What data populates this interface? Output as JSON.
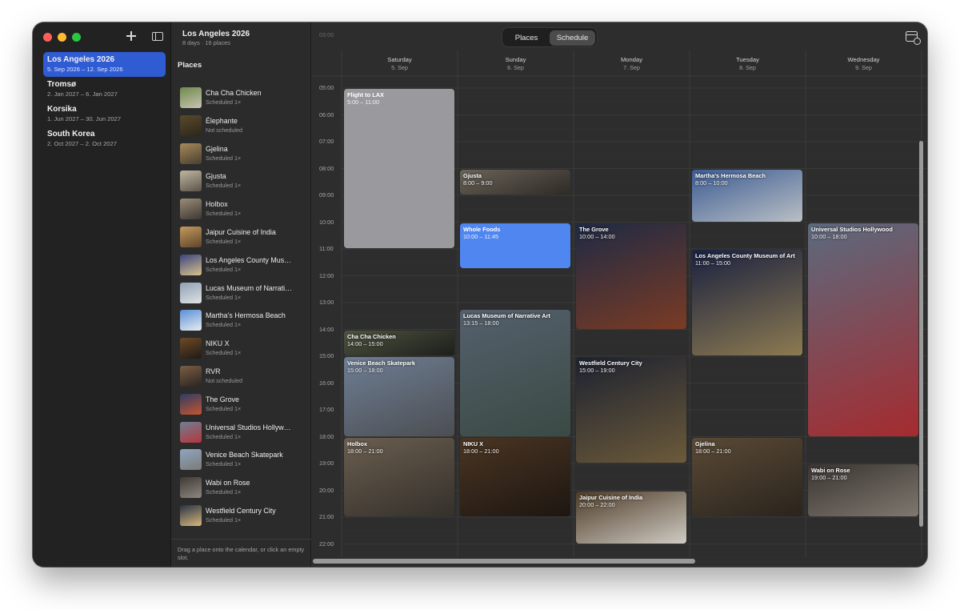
{
  "trip_header": {
    "title": "Los Angeles 2026",
    "subtitle": "8 days · 16 places"
  },
  "trips": [
    {
      "name": "Los Angeles 2026",
      "dates": "5. Sep 2026 – 12. Sep 2026",
      "selected": true
    },
    {
      "name": "Tromsø",
      "dates": "2. Jan 2027 – 6. Jan 2027",
      "selected": false
    },
    {
      "name": "Korsika",
      "dates": "1. Jun 2027 – 30. Jun 2027",
      "selected": false
    },
    {
      "name": "South Korea",
      "dates": "2. Oct 2027 – 2. Oct 2027",
      "selected": false
    }
  ],
  "places": {
    "title": "Places",
    "items": [
      {
        "name": "Cha Cha Chicken",
        "status": "Scheduled 1×",
        "thumb": [
          "#6d8a4a",
          "#c9c3b3"
        ]
      },
      {
        "name": "Élephante",
        "status": "Not scheduled",
        "thumb": [
          "#5a4a2d",
          "#2c2619"
        ]
      },
      {
        "name": "Gjelina",
        "status": "Scheduled 1×",
        "thumb": [
          "#a68a5c",
          "#4a3f2e"
        ]
      },
      {
        "name": "Gjusta",
        "status": "Scheduled 1×",
        "thumb": [
          "#c0b6a3",
          "#5c5548"
        ]
      },
      {
        "name": "Holbox",
        "status": "Scheduled 1×",
        "thumb": [
          "#9b8d78",
          "#3d3832"
        ]
      },
      {
        "name": "Jaipur Cuisine of India",
        "status": "Scheduled 1×",
        "thumb": [
          "#c49a5d",
          "#5e452b"
        ]
      },
      {
        "name": "Los Angeles County Mus…",
        "status": "Scheduled 1×",
        "thumb": [
          "#3b4480",
          "#d9c28a"
        ]
      },
      {
        "name": "Lucas Museum of Narrati…",
        "status": "Scheduled 1×",
        "thumb": [
          "#8ea0b4",
          "#dfe2e3"
        ]
      },
      {
        "name": "Martha's Hermosa Beach",
        "status": "Scheduled 1×",
        "thumb": [
          "#5b8fd6",
          "#e7ecef"
        ]
      },
      {
        "name": "NIKU X",
        "status": "Scheduled 1×",
        "thumb": [
          "#6f4a27",
          "#1f1a15"
        ]
      },
      {
        "name": "RVR",
        "status": "Not scheduled",
        "thumb": [
          "#7a5e44",
          "#2b2520"
        ]
      },
      {
        "name": "The Grove",
        "status": "Scheduled 1×",
        "thumb": [
          "#2d3c63",
          "#c6552f"
        ]
      },
      {
        "name": "Universal Studios Hollyw…",
        "status": "Scheduled 1×",
        "thumb": [
          "#6e7f94",
          "#b6363a"
        ]
      },
      {
        "name": "Venice Beach Skatepark",
        "status": "Scheduled 1×",
        "thumb": [
          "#8ea6c2",
          "#7d7a76"
        ]
      },
      {
        "name": "Wabi on Rose",
        "status": "Scheduled 1×",
        "thumb": [
          "#3f3935",
          "#8e8780"
        ]
      },
      {
        "name": "Westfield Century City",
        "status": "Scheduled 1×",
        "thumb": [
          "#2a3243",
          "#d7b77c"
        ]
      }
    ],
    "footer": "Drag a place onto the calendar, or click an empty slot."
  },
  "view_toggle": {
    "places": "Places",
    "schedule": "Schedule"
  },
  "days": [
    {
      "name": "Saturday",
      "date": "5. Sep"
    },
    {
      "name": "Sunday",
      "date": "6. Sep"
    },
    {
      "name": "Monday",
      "date": "7. Sep"
    },
    {
      "name": "Tuesday",
      "date": "8. Sep"
    },
    {
      "name": "Wednesday",
      "date": "9. Sep"
    }
  ],
  "hours": [
    "03:00",
    "05:00",
    "06:00",
    "07:00",
    "08:00",
    "09:00",
    "10:00",
    "11:00",
    "12:00",
    "13:00",
    "14:00",
    "15:00",
    "16:00",
    "17:00",
    "18:00",
    "19:00",
    "20:00",
    "21:00",
    "22:00"
  ],
  "events": [
    {
      "day": 0,
      "start": 5,
      "end": 11,
      "title": "Flight to LAX",
      "time": "5:00 – 11:00",
      "style": "plain"
    },
    {
      "day": 0,
      "start": 14,
      "end": 15,
      "title": "Cha Cha Chicken",
      "time": "14:00 – 15:00",
      "style": "photo",
      "colors": [
        "#4e5440",
        "#1d1e1b"
      ]
    },
    {
      "day": 0,
      "start": 15,
      "end": 18,
      "title": "Venice Beach Skatepark",
      "time": "15:00 – 18:00",
      "style": "photo",
      "colors": [
        "#6e7e94",
        "#4c4e52"
      ]
    },
    {
      "day": 0,
      "start": 18,
      "end": 21,
      "title": "Holbox",
      "time": "18:00 – 21:00",
      "style": "photo",
      "colors": [
        "#6a5e4f",
        "#34302b"
      ]
    },
    {
      "day": 1,
      "start": 8,
      "end": 9,
      "title": "Gjusta",
      "time": "8:00 – 9:00",
      "style": "photo",
      "colors": [
        "#6a6359",
        "#2e2a25"
      ]
    },
    {
      "day": 1,
      "start": 10,
      "end": 11.75,
      "title": "Whole Foods",
      "time": "10:00 – 11:45",
      "style": "blue"
    },
    {
      "day": 1,
      "start": 13.25,
      "end": 18,
      "title": "Lucas Museum of Narrative Art",
      "time": "13:15 – 18:00",
      "style": "photo",
      "colors": [
        "#55606d",
        "#3a4a43"
      ]
    },
    {
      "day": 1,
      "start": 18,
      "end": 21,
      "title": "NIKU X",
      "time": "18:00 – 21:00",
      "style": "photo",
      "colors": [
        "#4a3523",
        "#1d1611"
      ]
    },
    {
      "day": 2,
      "start": 10,
      "end": 14,
      "title": "The Grove",
      "time": "10:00 – 14:00",
      "style": "photo",
      "colors": [
        "#1f2a44",
        "#7a3b24"
      ]
    },
    {
      "day": 2,
      "start": 15,
      "end": 19,
      "title": "Westfield Century City",
      "time": "15:00 – 19:00",
      "style": "photo",
      "colors": [
        "#1d2230",
        "#6c5a3a"
      ]
    },
    {
      "day": 2,
      "start": 20,
      "end": 22,
      "title": "Jaipur Cuisine of India",
      "time": "20:00 – 22:00",
      "style": "photo",
      "colors": [
        "#4d3b27",
        "#cfcbc3"
      ]
    },
    {
      "day": 3,
      "start": 8,
      "end": 10,
      "title": "Martha's Hermosa Beach",
      "time": "8:00 – 10:00",
      "style": "photo",
      "colors": [
        "#3c5c93",
        "#b9bfc4"
      ]
    },
    {
      "day": 3,
      "start": 11,
      "end": 15,
      "title": "Los Angeles County Museum of Art",
      "time": "11:00 – 15:00",
      "style": "photo",
      "colors": [
        "#1a2140",
        "#8c7a50"
      ]
    },
    {
      "day": 3,
      "start": 18,
      "end": 21,
      "title": "Gjelina",
      "time": "18:00 – 21:00",
      "style": "photo",
      "colors": [
        "#5a4a36",
        "#2a241d"
      ]
    },
    {
      "day": 4,
      "start": 10,
      "end": 18,
      "title": "Universal Studios Hollywood",
      "time": "10:00 – 18:00",
      "style": "photo",
      "colors": [
        "#5b6a7e",
        "#a52b2f"
      ]
    },
    {
      "day": 4,
      "start": 19,
      "end": 21,
      "title": "Wabi on Rose",
      "time": "19:00 – 21:00",
      "style": "photo",
      "colors": [
        "#3a3531",
        "#7f786f"
      ]
    }
  ]
}
